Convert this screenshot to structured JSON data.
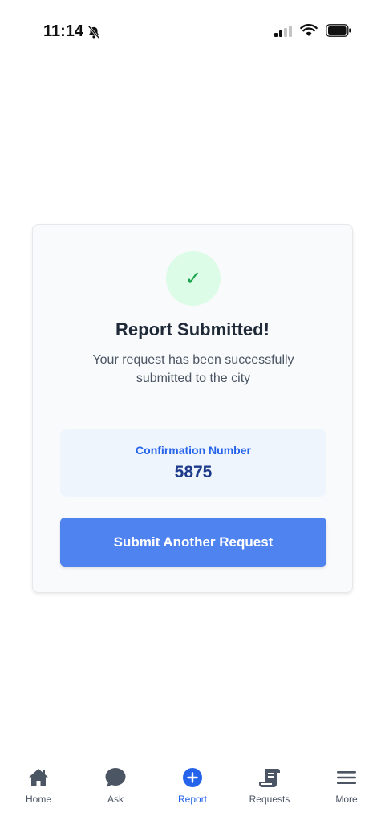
{
  "status_bar": {
    "time": "11:14",
    "icons": [
      "bell-off-icon",
      "signal-icon",
      "wifi-icon",
      "battery-icon"
    ]
  },
  "card": {
    "icon": "checkmark-icon",
    "icon_glyph": "✓",
    "title": "Report Submitted!",
    "description": "Your request has been successfully submitted to the city",
    "confirmation": {
      "label": "Confirmation Number",
      "number": "5875"
    },
    "button_label": "Submit Another Request"
  },
  "nav": {
    "items": [
      {
        "label": "Home",
        "icon": "home-icon",
        "active": false
      },
      {
        "label": "Ask",
        "icon": "chat-bubble-icon",
        "active": false
      },
      {
        "label": "Report",
        "icon": "plus-circle-icon",
        "active": true
      },
      {
        "label": "Requests",
        "icon": "scroll-icon",
        "active": false
      },
      {
        "label": "More",
        "icon": "menu-icon",
        "active": false
      }
    ]
  },
  "colors": {
    "accent": "#2563eb",
    "button": "#4f83f0",
    "success": "#16a34a",
    "success_bg": "#dcfce7"
  }
}
